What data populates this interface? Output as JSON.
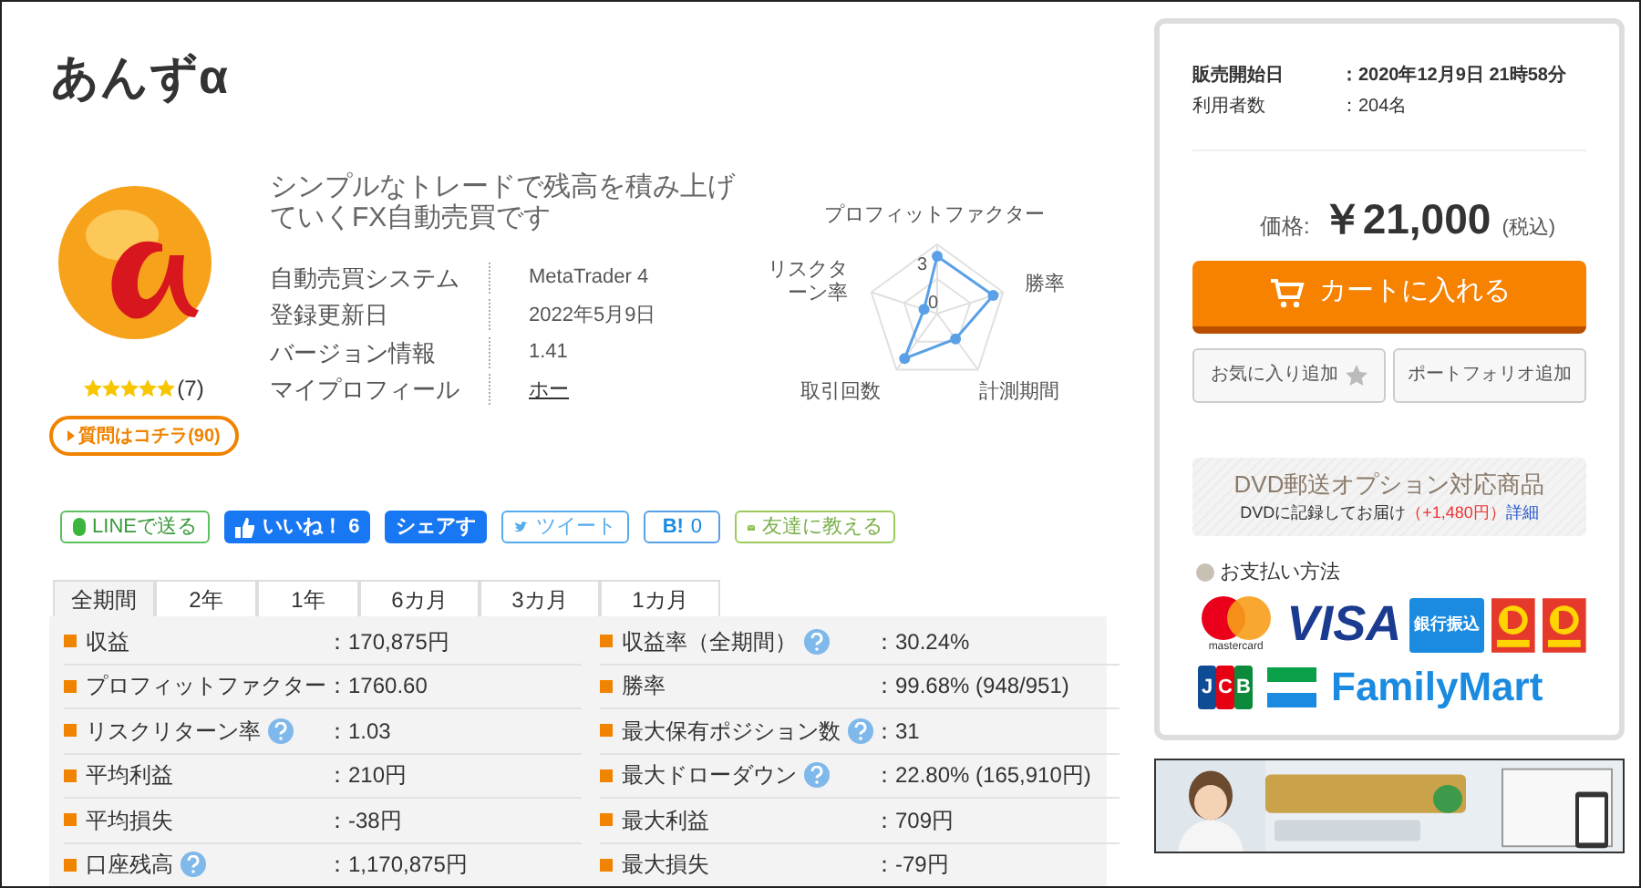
{
  "product": {
    "title": "あんずα",
    "stars": 5,
    "review_count": "(7)",
    "question_button": "質問はコチラ(90)",
    "description": "シンプルなトレードで残高を積み上げていくFX自動売買です",
    "specs": [
      {
        "label": "自動売買システム",
        "value": "MetaTrader 4",
        "kind": "text"
      },
      {
        "label": "登録更新日",
        "value": "2022年5月9日",
        "kind": "text"
      },
      {
        "label": "バージョン情報",
        "value": "1.41",
        "kind": "text"
      },
      {
        "label": "マイプロフィール",
        "value": "ホー",
        "kind": "link"
      }
    ]
  },
  "radar": {
    "labels": [
      "プロフィットファクター",
      "リスクターン率",
      "勝率",
      "取引回数",
      "計測期間"
    ],
    "ticks": [
      "3",
      "0"
    ]
  },
  "share": [
    {
      "kind": "line",
      "label": "LINEで送る"
    },
    {
      "kind": "like",
      "label": "いいね！",
      "count": "6"
    },
    {
      "kind": "share",
      "label": "シェアす"
    },
    {
      "kind": "tweet",
      "label": "ツイート"
    },
    {
      "kind": "hatena",
      "label": "B!",
      "count": "0"
    },
    {
      "kind": "mail",
      "label": "友達に教える"
    }
  ],
  "tabs": [
    {
      "label": "全期間",
      "selected": true
    },
    {
      "label": "2年",
      "selected": false
    },
    {
      "label": "1年",
      "selected": false
    },
    {
      "label": "6カ月",
      "selected": false
    },
    {
      "label": "3カ月",
      "selected": false
    },
    {
      "label": "1カ月",
      "selected": false
    }
  ],
  "stats_left": [
    {
      "label": "収益",
      "help": false,
      "value": "：170,875円"
    },
    {
      "label": "プロフィットファクター",
      "help": false,
      "value": "：1760.60"
    },
    {
      "label": "リスクリターン率",
      "help": true,
      "value": "：1.03"
    },
    {
      "label": "平均利益",
      "help": false,
      "value": "：210円"
    },
    {
      "label": "平均損失",
      "help": false,
      "value": "：-38円"
    },
    {
      "label": "口座残高",
      "help": true,
      "value": "：1,170,875円"
    }
  ],
  "stats_right": [
    {
      "label": "収益率（全期間）",
      "help": true,
      "value": "：30.24%"
    },
    {
      "label": "勝率",
      "help": false,
      "value": "：99.68% (948/951)"
    },
    {
      "label": "最大保有ポジション数",
      "help": true,
      "value": "：31"
    },
    {
      "label": "最大ドローダウン",
      "help": true,
      "value": "：22.80% (165,910円)"
    },
    {
      "label": "最大利益",
      "help": false,
      "value": "：709円"
    },
    {
      "label": "最大損失",
      "help": false,
      "value": "：-79円"
    }
  ],
  "sale_info": [
    {
      "label": "販売開始日",
      "value": "：2020年12月9日 21時58分",
      "bold": true
    },
    {
      "label": "利用者数",
      "value": "：204名",
      "bold": false
    }
  ],
  "price": {
    "label": "価格:",
    "amount": "￥21,000",
    "tax": "(税込)"
  },
  "cart_button": "カートに入れる",
  "favorite_button": "お気に入り追加",
  "portfolio_button": "ポートフォリオ追加",
  "dvd": {
    "title": "DVD郵送オプション対応商品",
    "text": "DVDに記録してお届け",
    "price": "（+1,480円）",
    "link": "詳細"
  },
  "payment": {
    "title": "お支払い方法",
    "methods": [
      {
        "kind": "mastercard",
        "label": "mastercard"
      },
      {
        "kind": "visa",
        "label": "VISA"
      },
      {
        "kind": "bank",
        "label": "銀行振込"
      },
      {
        "kind": "daily"
      },
      {
        "kind": "daily"
      },
      {
        "kind": "jcb",
        "label": "JCB"
      },
      {
        "kind": "familymart",
        "label": "FamilyMart"
      }
    ]
  }
}
